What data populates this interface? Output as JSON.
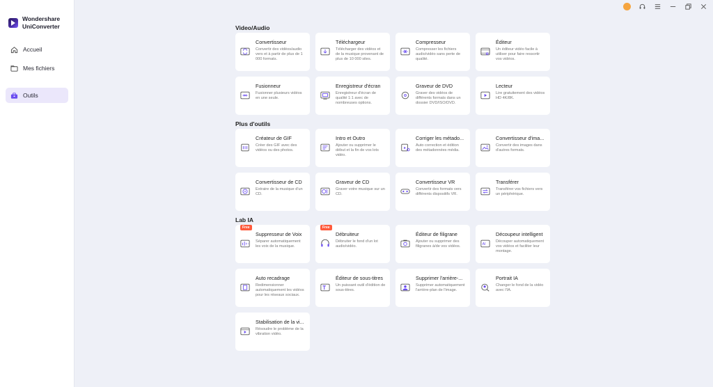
{
  "brand": {
    "line1": "Wondershare",
    "line2": "UniConverter"
  },
  "sidebar": {
    "items": [
      {
        "label": "Accueil",
        "icon": "home-icon"
      },
      {
        "label": "Mes fichiers",
        "icon": "folder-icon"
      },
      {
        "label": "Outils",
        "icon": "toolbox-icon",
        "active": true
      }
    ]
  },
  "titlebar": {
    "icons": [
      "avatar-icon",
      "headset-icon",
      "menu-icon",
      "minimize-icon",
      "restore-icon",
      "close-icon"
    ]
  },
  "colors": {
    "accent": "#6a4cf0",
    "free_badge": "#ff5a3c",
    "background": "#eef0f7"
  },
  "sections": [
    {
      "title": "Video/Audio",
      "cards": [
        {
          "title": "Convertisseur",
          "desc": "Convertir des vidéos/audio vers et à partir de plus de 1 000 formats.",
          "icon": "convert-icon"
        },
        {
          "title": "Téléchargeur",
          "desc": "Télécharger des vidéos et de la musique provenant de plus de 10 000 sites.",
          "icon": "download-icon"
        },
        {
          "title": "Compresseur",
          "desc": "Compresser les fichiers audio/vidéo sans perte de qualité.",
          "icon": "compress-icon"
        },
        {
          "title": "Éditeur",
          "desc": "Un éditeur vidéo facile à utiliser pour faire ressortir vos vidéos.",
          "icon": "edit-icon"
        },
        {
          "title": "Fusionneur",
          "desc": "Fusionner plusieurs vidéos en une seule.",
          "icon": "merge-icon"
        },
        {
          "title": "Enregistreur d'écran",
          "desc": "Enregistreur d'écran de qualité 1:1 avec de nombreuses options.",
          "icon": "screen-record-icon"
        },
        {
          "title": "Graveur de DVD",
          "desc": "Graver des vidéos de différents formats dans un dossier DVD/ISO/DVD.",
          "icon": "dvd-icon"
        },
        {
          "title": "Lecteur",
          "desc": "Lire gratuitement des vidéos HD 4K/8K.",
          "icon": "player-icon"
        }
      ]
    },
    {
      "title": "Plus d'outils",
      "cards": [
        {
          "title": "Créateur de GIF",
          "desc": "Créer des GIF avec des vidéos ou des photos.",
          "icon": "gif-icon"
        },
        {
          "title": "Intro et Outro",
          "desc": "Ajouter ou supprimer le début et la fin de vos lots vidéo.",
          "icon": "intro-icon"
        },
        {
          "title": "Corriger les métado...",
          "desc": "Auto correction et édition des métadonnées média.",
          "icon": "metadata-icon"
        },
        {
          "title": "Convertisseur d'ima...",
          "desc": "Convertir des images dans d'autres formats.",
          "icon": "image-convert-icon"
        },
        {
          "title": "Convertisseur de CD",
          "desc": "Extraire de la musique d'un CD.",
          "icon": "cd-convert-icon"
        },
        {
          "title": "Graveur de CD",
          "desc": "Graver votre musique sur un CD.",
          "icon": "cd-burn-icon"
        },
        {
          "title": "Convertisseur VR",
          "desc": "Convertir des formats vers différents dispositifs VR.",
          "icon": "vr-icon"
        },
        {
          "title": "Transférer",
          "desc": "Transférer vos fichiers vers un périphérique.",
          "icon": "transfer-icon"
        }
      ]
    },
    {
      "title": "Lab IA",
      "cards": [
        {
          "title": "Suppresseur de Voix",
          "desc": "Séparer automatiquement les voix de la musique.",
          "icon": "voice-remove-icon",
          "badge": "Free"
        },
        {
          "title": "Débruiteur",
          "desc": "Débruiter le fond d'un lot audio/vidéo.",
          "icon": "denoise-icon",
          "badge": "Free"
        },
        {
          "title": "Éditeur de filigrane",
          "desc": "Ajouter ou supprimer des filigranes à/de vos vidéos.",
          "icon": "watermark-icon"
        },
        {
          "title": "Découpeur intelligent",
          "desc": "Découper automatiquement vos vidéos et faciliter leur montage.",
          "icon": "ai-cutter-icon"
        },
        {
          "title": "Auto recadrage",
          "desc": "Redimensionner automatiquement les vidéos pour les réseaux sociaux.",
          "icon": "reframe-icon"
        },
        {
          "title": "Éditeur de sous-titres",
          "desc": "Un puissant outil d'édition de sous-titres.",
          "icon": "subtitle-icon"
        },
        {
          "title": "Supprimer l'arrière-...",
          "desc": "Supprimer automatiquement l'arrière-plan de l'image.",
          "icon": "bg-remove-icon"
        },
        {
          "title": "Portrait IA",
          "desc": "Changer le fond de la vidéo avec l'IA.",
          "icon": "portrait-icon"
        },
        {
          "title": "Stabilisation de la vi...",
          "desc": "Résoudre le problème de la vibration vidéo.",
          "icon": "stabilize-icon"
        }
      ]
    }
  ]
}
